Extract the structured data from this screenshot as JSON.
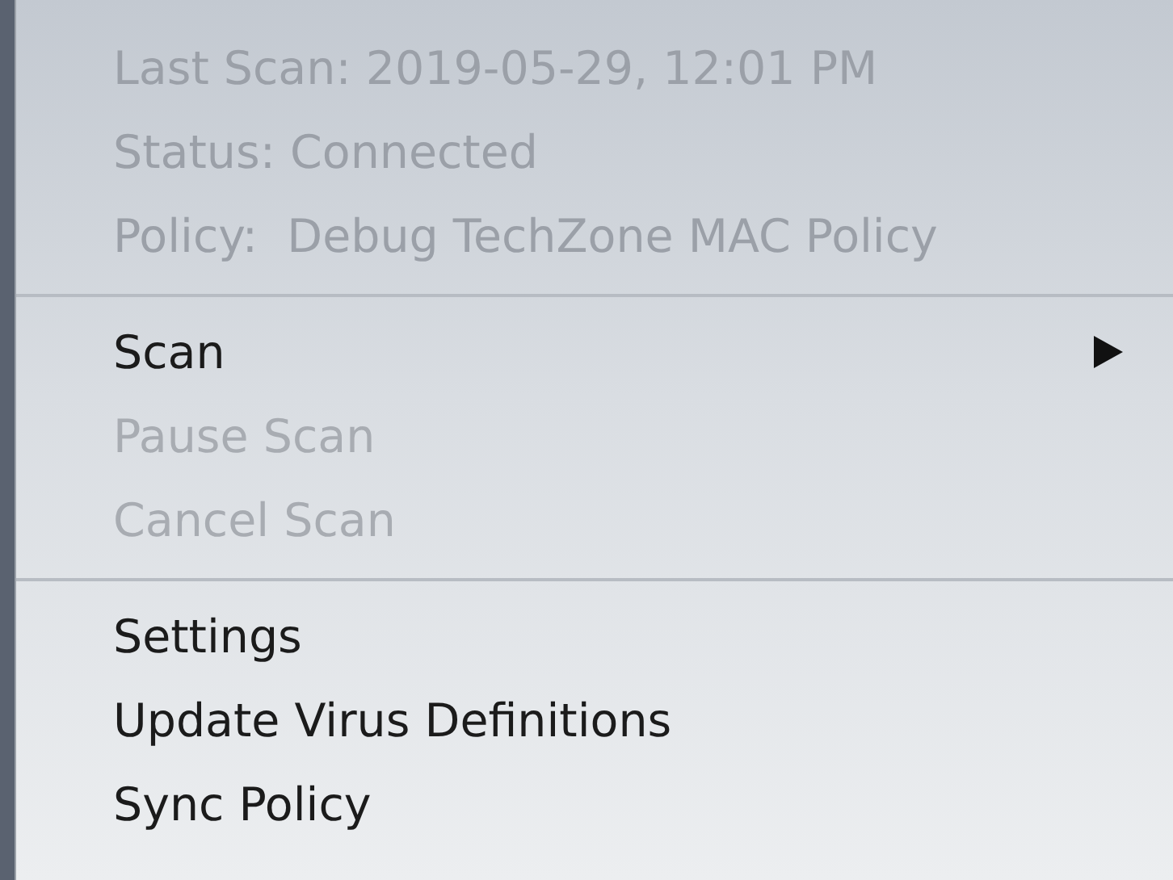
{
  "info": [
    "Last Scan: 2019-05-29, 12:01 PM",
    "Status: Connected",
    "Policy:  Debug TechZone MAC Policy"
  ],
  "groups": [
    [
      {
        "label": "Scan",
        "disabled": false,
        "submenu": true
      },
      {
        "label": "Pause Scan",
        "disabled": true,
        "submenu": false
      },
      {
        "label": "Cancel Scan",
        "disabled": true,
        "submenu": false
      }
    ],
    [
      {
        "label": "Settings",
        "disabled": false,
        "submenu": false
      },
      {
        "label": "Update Virus Definitions",
        "disabled": false,
        "submenu": false
      },
      {
        "label": "Sync Policy",
        "disabled": false,
        "submenu": false
      }
    ]
  ]
}
